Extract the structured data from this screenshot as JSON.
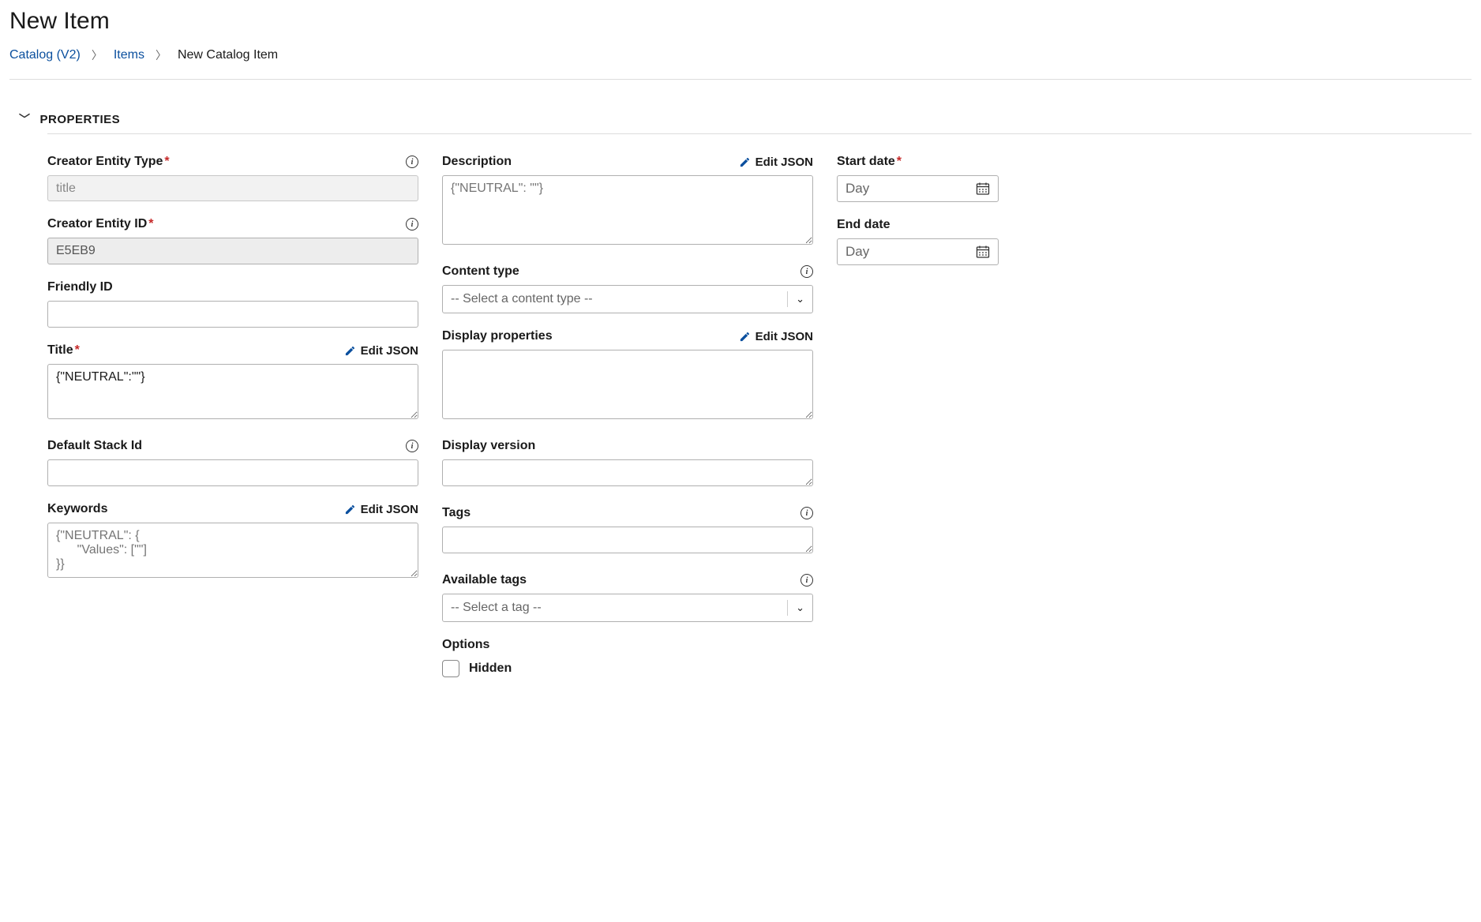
{
  "page": {
    "title": "New Item"
  },
  "breadcrumb": {
    "root": "Catalog (V2)",
    "items": "Items",
    "current": "New Catalog Item"
  },
  "section": {
    "properties_label": "PROPERTIES"
  },
  "actions": {
    "edit_json": "Edit JSON"
  },
  "fields": {
    "creator_entity_type": {
      "label": "Creator Entity Type",
      "value": "title"
    },
    "creator_entity_id": {
      "label": "Creator Entity ID",
      "value": "E5EB9"
    },
    "friendly_id": {
      "label": "Friendly ID",
      "value": ""
    },
    "title": {
      "label": "Title",
      "value": "{\"NEUTRAL\":\"\"}"
    },
    "default_stack_id": {
      "label": "Default Stack Id",
      "value": ""
    },
    "keywords": {
      "label": "Keywords",
      "placeholder": "{\"NEUTRAL\": {\n      \"Values\": [\"\"]\n}}"
    },
    "description": {
      "label": "Description",
      "placeholder": "{\"NEUTRAL\": \"\"}"
    },
    "content_type": {
      "label": "Content type",
      "placeholder": "-- Select a content type --"
    },
    "display_properties": {
      "label": "Display properties",
      "value": ""
    },
    "display_version": {
      "label": "Display version",
      "value": ""
    },
    "tags": {
      "label": "Tags",
      "value": ""
    },
    "available_tags": {
      "label": "Available tags",
      "placeholder": "-- Select a tag --"
    },
    "options": {
      "label": "Options",
      "hidden_label": "Hidden"
    },
    "start_date": {
      "label": "Start date",
      "placeholder": "Day"
    },
    "end_date": {
      "label": "End date",
      "placeholder": "Day"
    }
  }
}
